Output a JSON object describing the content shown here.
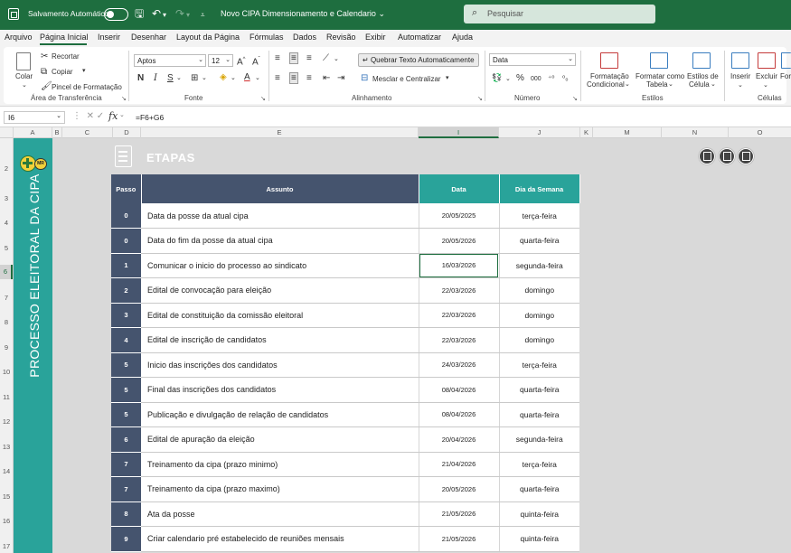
{
  "titlebar": {
    "autosave_label": "Salvamento Automático",
    "doc_title": "Novo CIPA Dimensionamento e Calendario",
    "search_placeholder": "Pesquisar"
  },
  "menu": [
    "Arquivo",
    "Página Inicial",
    "Inserir",
    "Desenhar",
    "Layout da Página",
    "Fórmulas",
    "Dados",
    "Revisão",
    "Exibir",
    "Automatizar",
    "Ajuda"
  ],
  "ribbon": {
    "clipboard": {
      "paste": "Colar",
      "cut": "Recortar",
      "copy": "Copiar",
      "format_painter": "Pincel de Formatação",
      "group": "Área de Transferência"
    },
    "font": {
      "name": "Aptos",
      "size": "12",
      "group": "Fonte"
    },
    "alignment": {
      "wrap_text": "Quebrar Texto Automaticamente",
      "merge_center": "Mesclar e Centralizar",
      "group": "Alinhamento"
    },
    "number": {
      "format": "Data",
      "group": "Número"
    },
    "styles": {
      "conditional_1": "Formatação",
      "conditional_2": "Condicional",
      "format_table_1": "Formatar como",
      "format_table_2": "Tabela",
      "cell_styles_1": "Estilos de",
      "cell_styles_2": "Célula",
      "group": "Estilos"
    },
    "cells": {
      "insert": "Inserir",
      "delete": "Excluir",
      "format": "For",
      "group": "Células"
    }
  },
  "formula_bar": {
    "cell_ref": "I6",
    "formula": "=F6+G6"
  },
  "columns": [
    "A",
    "B",
    "C",
    "D",
    "E",
    "I",
    "J",
    "K",
    "M",
    "N",
    "O"
  ],
  "rows": [
    "2",
    "3",
    "4",
    "5",
    "6",
    "7",
    "8",
    "9",
    "10",
    "11",
    "12",
    "13",
    "14",
    "15",
    "16",
    "17"
  ],
  "sheet": {
    "vertical_title": "PROCESSO ELEITORAL DA CIPA",
    "section_title": "ETAPAS",
    "logo_text": "MR",
    "headers": {
      "passo": "Passo",
      "assunto": "Assunto",
      "data": "Data",
      "dia": "Dia da Semana"
    },
    "steps": [
      {
        "passo": "0",
        "assunto": "Data da posse da atual cipa",
        "data": "20/05/2025",
        "dia": "terça-feira"
      },
      {
        "passo": "0",
        "assunto": "Data do fim da posse da atual cipa",
        "data": "20/05/2026",
        "dia": "quarta-feira"
      },
      {
        "passo": "1",
        "assunto": "Comunicar o inicio do processo ao sindicato",
        "data": "16/03/2026",
        "dia": "segunda-feira"
      },
      {
        "passo": "2",
        "assunto": "Edital de convocação para eleição",
        "data": "22/03/2026",
        "dia": "domingo"
      },
      {
        "passo": "3",
        "assunto": "Edital de constituição da comissão eleitoral",
        "data": "22/03/2026",
        "dia": "domingo"
      },
      {
        "passo": "4",
        "assunto": "Edital de inscrição de candidatos",
        "data": "22/03/2026",
        "dia": "domingo"
      },
      {
        "passo": "5",
        "assunto": "Inicio das inscrições dos candidatos",
        "data": "24/03/2026",
        "dia": "terça-feira"
      },
      {
        "passo": "5",
        "assunto": "Final das inscrições dos candidatos",
        "data": "08/04/2026",
        "dia": "quarta-feira"
      },
      {
        "passo": "5",
        "assunto": "Publicação e divulgação de relação de candidatos",
        "data": "08/04/2026",
        "dia": "quarta-feira"
      },
      {
        "passo": "6",
        "assunto": "Edital de apuração da eleição",
        "data": "20/04/2026",
        "dia": "segunda-feira"
      },
      {
        "passo": "7",
        "assunto": "Treinamento da cipa (prazo minimo)",
        "data": "21/04/2026",
        "dia": "terça-feira"
      },
      {
        "passo": "7",
        "assunto": "Treinamento da cipa (prazo maximo)",
        "data": "20/05/2026",
        "dia": "quarta-feira"
      },
      {
        "passo": "8",
        "assunto": "Ata da posse",
        "data": "21/05/2026",
        "dia": "quinta-feira"
      },
      {
        "passo": "9",
        "assunto": "Criar calendario pré estabelecido de reuniões mensais",
        "data": "21/05/2026",
        "dia": "quinta-feira"
      }
    ]
  }
}
